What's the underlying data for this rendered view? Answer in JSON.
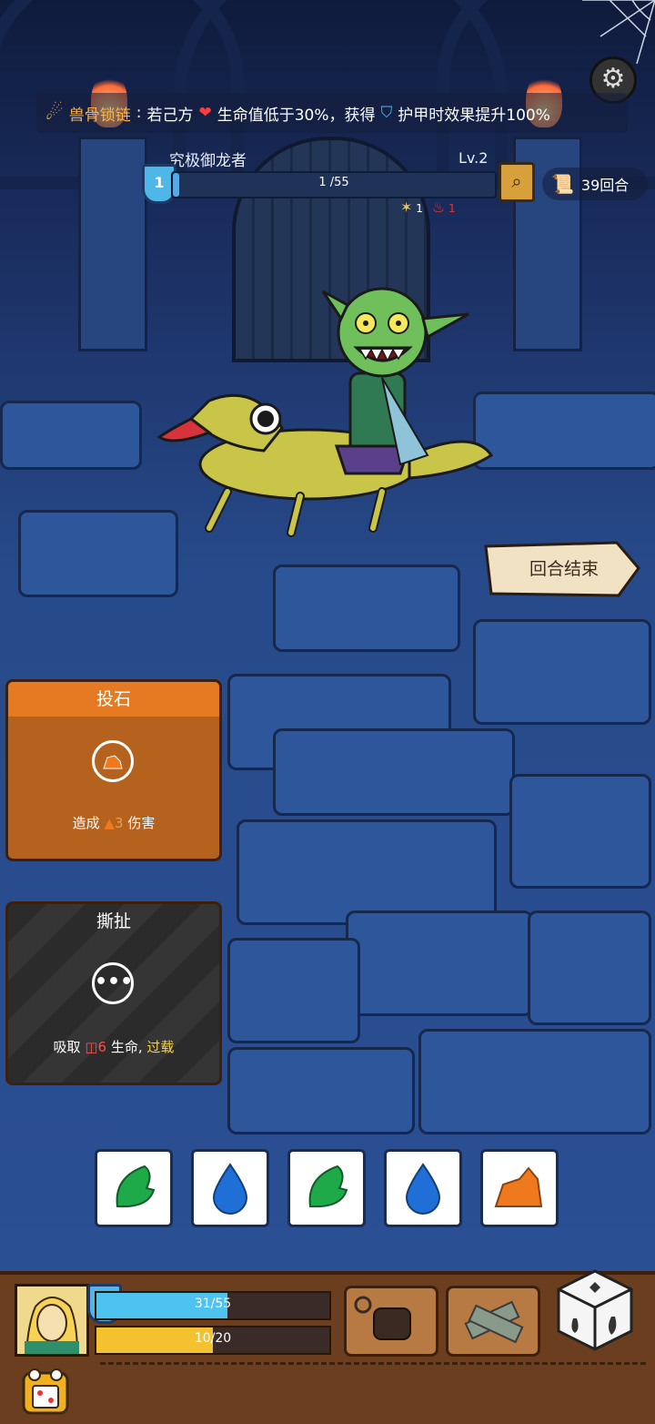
{
  "banner": {
    "prefix": "兽骨锁链",
    "text": "若己方",
    "text2": "生命值低于30%，获得",
    "text3": "护甲时效果提升100%"
  },
  "enemy": {
    "name": "究极御龙者",
    "level": "Lv.2",
    "shield": "1",
    "hp_text": "1 /55",
    "hp_fraction": 0.02,
    "status_1_count": "1",
    "status_2_count": "1"
  },
  "rounds": {
    "label": "39回合"
  },
  "end_turn": {
    "label": "回合结束"
  },
  "cards": [
    {
      "title": "投石",
      "desc_prefix": "造成",
      "desc_value": "3",
      "desc_suffix": "伤害",
      "color": "#b5621f",
      "header_color": "#e67a22"
    },
    {
      "title": "撕扯",
      "desc_prefix": "吸取",
      "desc_value": "6",
      "desc_mid": "生命,",
      "desc_keyword": "过载",
      "color": "#2b2b2b",
      "header_color": "#333333"
    }
  ],
  "dice": [
    {
      "icon": "leaf-icon",
      "color": "#1faa4a"
    },
    {
      "icon": "water-drop-icon",
      "color": "#1f6fd6"
    },
    {
      "icon": "leaf-icon",
      "color": "#1faa4a"
    },
    {
      "icon": "water-drop-icon",
      "color": "#1f6fd6"
    },
    {
      "icon": "rock-icon",
      "color": "#ef7a1e"
    }
  ],
  "player": {
    "shield": "5",
    "hp_text": "31/55",
    "hp_fraction": 0.564,
    "energy_text": "10/20",
    "energy_fraction": 0.5
  }
}
